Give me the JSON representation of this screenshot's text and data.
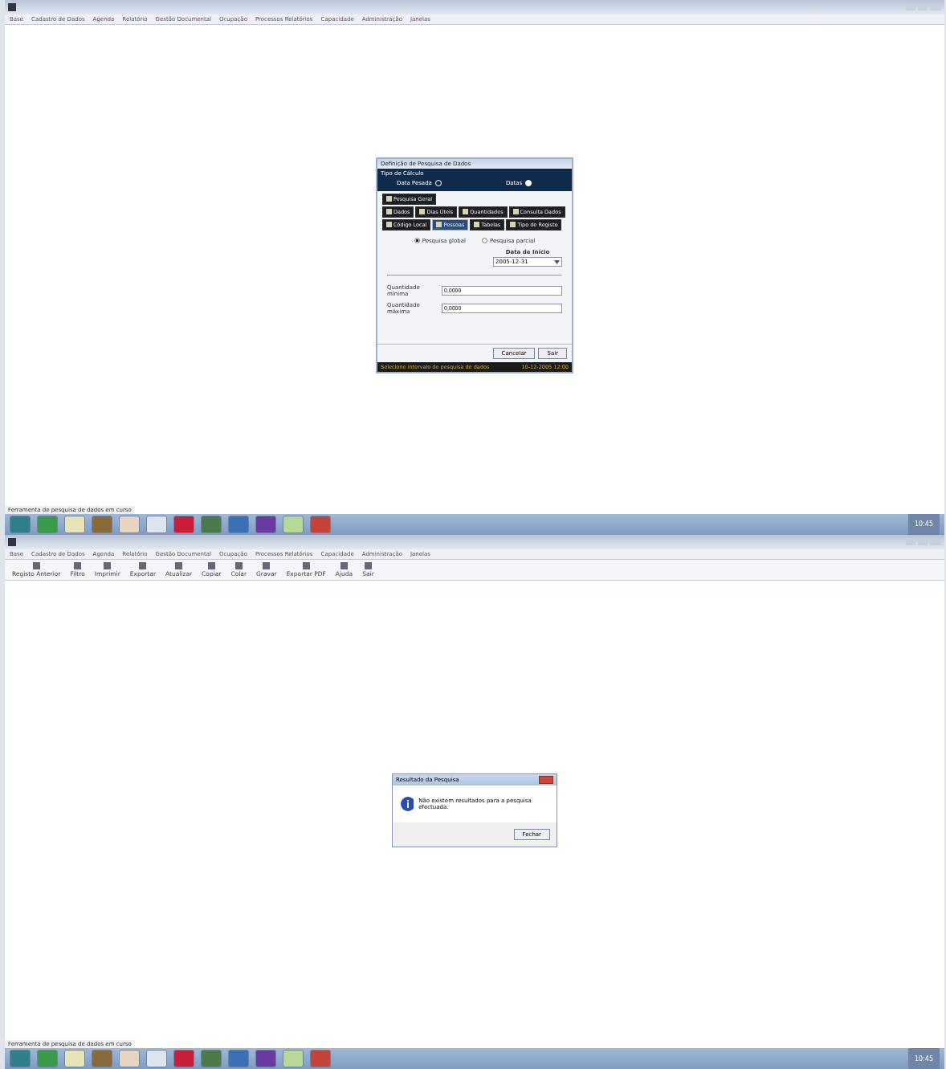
{
  "top_screen": {
    "menu": [
      "Base",
      "Cadastro de Dados",
      "Agenda",
      "Relatório",
      "Gestão Documental",
      "Ocupação",
      "Processos Relatórios",
      "Capacidade",
      "Administração",
      "Janelas"
    ],
    "dialog": {
      "title": "Definição de Pesquisa de Dados",
      "header": "Tipo de Cálculo",
      "calc_options": [
        {
          "label": "Data Pesada",
          "selected": false
        },
        {
          "label": "Datas",
          "selected": true
        }
      ],
      "tab_rows": [
        [
          {
            "label": "Pesquisa Geral",
            "selected": false
          }
        ],
        [
          {
            "label": "Dados",
            "selected": false
          },
          {
            "label": "Dias Úteis",
            "selected": false
          },
          {
            "label": "Quantidades",
            "selected": false
          },
          {
            "label": "Consulta Dados",
            "selected": false
          }
        ],
        [
          {
            "label": "Código Local",
            "selected": false
          },
          {
            "label": "Pessoas",
            "selected": true
          },
          {
            "label": "Tabelas",
            "selected": false
          },
          {
            "label": "Tipo de Registo",
            "selected": false
          }
        ]
      ],
      "search_options": [
        {
          "label": "Pesquisa global",
          "selected": true
        },
        {
          "label": "Pesquisa parcial",
          "selected": false
        }
      ],
      "date_label": "Data de Início",
      "date_value": "2005-12-31",
      "fields": [
        {
          "label": "Quantidade mínima",
          "value": "0,0000"
        },
        {
          "label": "Quantidade máxima",
          "value": "0,0000"
        }
      ],
      "buttons": [
        "Cancelar",
        "Sair"
      ],
      "status": "Selecione intervalo de pesquisa de dados",
      "status_right": "10-12-2005 12:00"
    },
    "status_text": "Ferramenta de pesquisa de dados em curso",
    "clock": "10:45"
  },
  "bottom_screen": {
    "menu": [
      "Base",
      "Cadastro de Dados",
      "Agenda",
      "Relatório",
      "Gestão Documental",
      "Ocupação",
      "Processos Relatórios",
      "Capacidade",
      "Administração",
      "Janelas"
    ],
    "toolbar": [
      "Registo Anterior",
      "Filtro",
      "Imprimir",
      "Exportar",
      "Atualizar",
      "Copiar",
      "Colar",
      "Gravar",
      "Exportar PDF",
      "Ajuda",
      "Sair"
    ],
    "message_box": {
      "title": "Resultado da Pesquisa",
      "text": "Não existem resultados para a pesquisa efectuada.",
      "button": "Fechar"
    },
    "status_text": "Ferramenta de pesquisa de dados em curso",
    "clock": "10:45"
  }
}
